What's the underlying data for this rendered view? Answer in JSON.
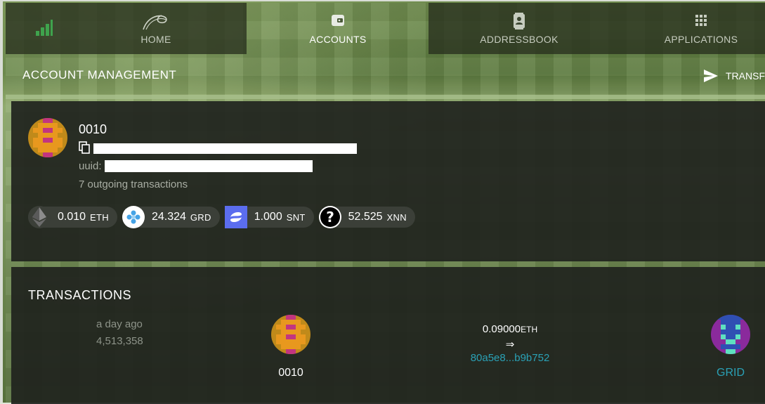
{
  "nav": {
    "tabs": [
      {
        "label": "HOME",
        "icon": "home-swirl-icon"
      },
      {
        "label": "ACCOUNTS",
        "icon": "wallet-icon"
      },
      {
        "label": "ADDRESSBOOK",
        "icon": "addressbook-icon"
      },
      {
        "label": "APPLICATIONS",
        "icon": "apps-grid-icon"
      }
    ],
    "active": "ACCOUNTS",
    "status_icon": "signal-bars-icon",
    "status_color": "#3fa34d"
  },
  "header": {
    "title": "ACCOUNT MANAGEMENT",
    "transfer_label": "TRANSFE"
  },
  "account": {
    "name": "0010",
    "uuid_label": "uuid:",
    "outgoing": "7 outgoing transactions",
    "balances": [
      {
        "amount": "0.010",
        "symbol": "ETH",
        "icon": "ethereum-icon"
      },
      {
        "amount": "24.324",
        "symbol": "GRD",
        "icon": "grid-coin-icon"
      },
      {
        "amount": "1.000",
        "symbol": "SNT",
        "icon": "status-coin-icon"
      },
      {
        "amount": "52.525",
        "symbol": "XNN",
        "icon": "unknown-coin-icon"
      }
    ]
  },
  "transactions": {
    "title": "TRANSACTIONS",
    "rows": [
      {
        "time": "a day ago",
        "block": "4,513,358",
        "from": "0010",
        "amount": "0.09000",
        "unit": "ETH",
        "arrow": "⇒",
        "hash": "80a5e8...b9b752",
        "to": "GRID"
      }
    ]
  },
  "colors": {
    "accent_link": "#2aa1b6",
    "card_bg": "#20241e",
    "muted_text": "#a8ada3"
  }
}
